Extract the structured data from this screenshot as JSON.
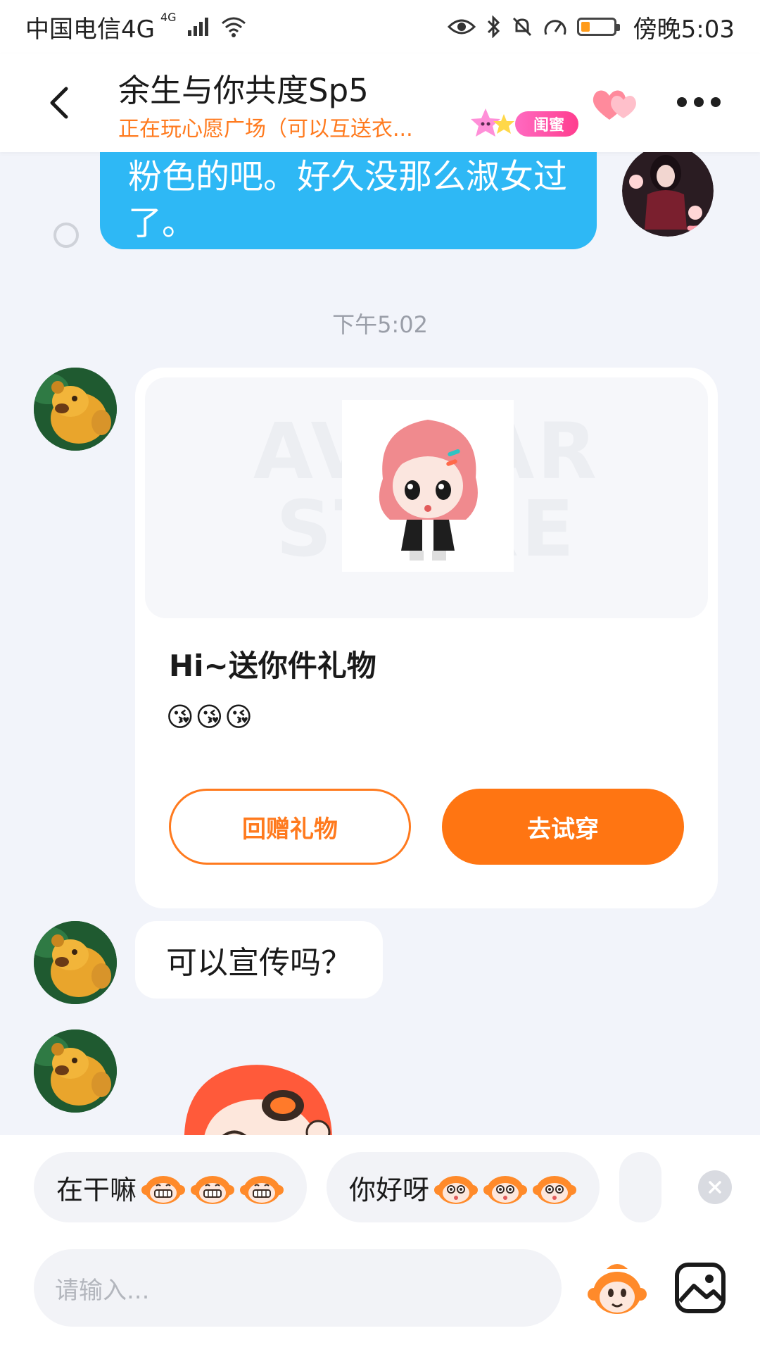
{
  "status_bar": {
    "carrier": "中国电信4G",
    "network_sup": "4G",
    "time": "傍晚5:03"
  },
  "header": {
    "title": "余生与你共度Sp5",
    "subtitle": "正在玩心愿广场（可以互送衣...",
    "relation_badge": "闺蜜"
  },
  "messages": {
    "self_partial_text": "粉色的吧。好久没那么淑女过了。",
    "timestamp": "下午5:02",
    "gift_card": {
      "watermark": "AVATAR STORE",
      "title": "Hi~送你件礼物",
      "emojis": "😘😘😘",
      "return_gift_label": "回赠礼物",
      "try_on_label": "去试穿"
    },
    "text_message": "可以宣传吗？"
  },
  "quick_replies": [
    {
      "text": "在干嘛",
      "icon": "grinning-monkey-icon"
    },
    {
      "text": "你好呀",
      "icon": "surprised-monkey-icon"
    }
  ],
  "input": {
    "placeholder": "请输入..."
  },
  "colors": {
    "accent_orange": "#ff7512",
    "self_bubble_blue": "#2eb8f5",
    "badge_pink": "#ff3d8e"
  }
}
